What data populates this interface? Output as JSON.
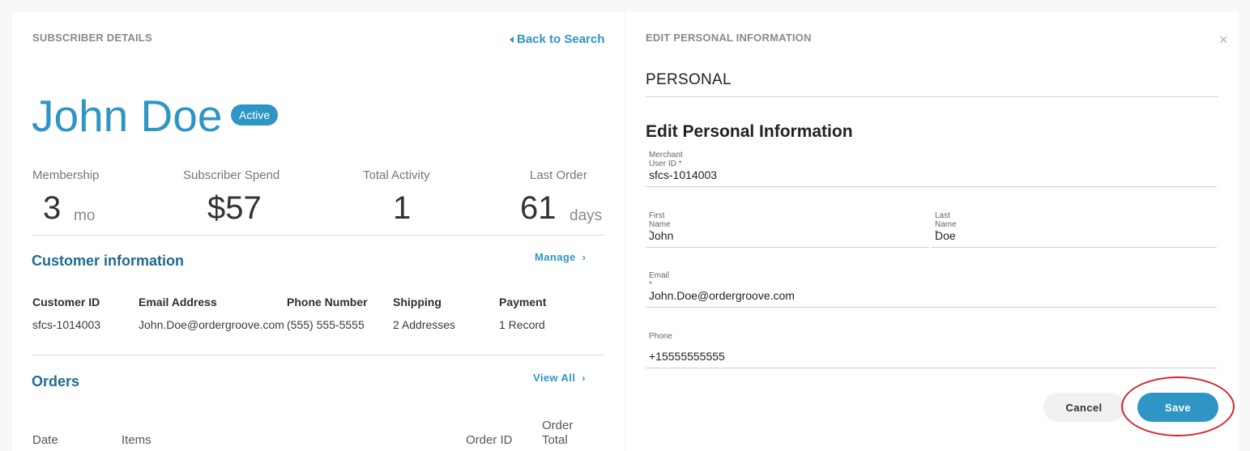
{
  "left": {
    "section_label": "SUBSCRIBER DETAILS",
    "back_link": "Back to Search",
    "name": "John Doe",
    "status": "Active",
    "stats": [
      {
        "label": "Membership",
        "value": "3",
        "unit": "mo"
      },
      {
        "label": "Subscriber Spend",
        "value": "$57",
        "unit": ""
      },
      {
        "label": "Total Activity",
        "value": "1",
        "unit": ""
      },
      {
        "label": "Last Order",
        "value": "61",
        "unit": "days"
      }
    ],
    "customer": {
      "title": "Customer information",
      "link": "Manage",
      "columns": [
        "Customer ID",
        "Email Address",
        "Phone Number",
        "Shipping",
        "Payment"
      ],
      "values": [
        "sfcs-1014003",
        "John.Doe@ordergroove.com",
        "(555) 555-5555",
        "2 Addresses",
        "1 Record"
      ]
    },
    "orders": {
      "title": "Orders",
      "link": "View All",
      "columns": [
        "Date",
        "Items",
        "Order ID",
        "Order Total"
      ]
    }
  },
  "right": {
    "section_label": "EDIT PERSONAL INFORMATION",
    "close_label": "×",
    "heading": "PERSONAL",
    "form_title": "Edit Personal Information",
    "fields": {
      "merchant_user_id": {
        "label": "Merchant User ID *",
        "value": "sfcs-1014003"
      },
      "first_name": {
        "label": "First Name *",
        "value": "John"
      },
      "last_name": {
        "label": "Last Name *",
        "value": "Doe"
      },
      "email": {
        "label": "Email *",
        "value": "John.Doe@ordergroove.com"
      },
      "phone": {
        "label": "Phone",
        "value": "+15555555555"
      }
    },
    "cancel_label": "Cancel",
    "save_label": "Save"
  },
  "colors": {
    "accent": "#2f95c4",
    "section_title": "#1f6b8f",
    "highlight": "#d9222a"
  },
  "icons": [
    "caret-left-icon",
    "chevron-right-icon",
    "close-icon"
  ]
}
